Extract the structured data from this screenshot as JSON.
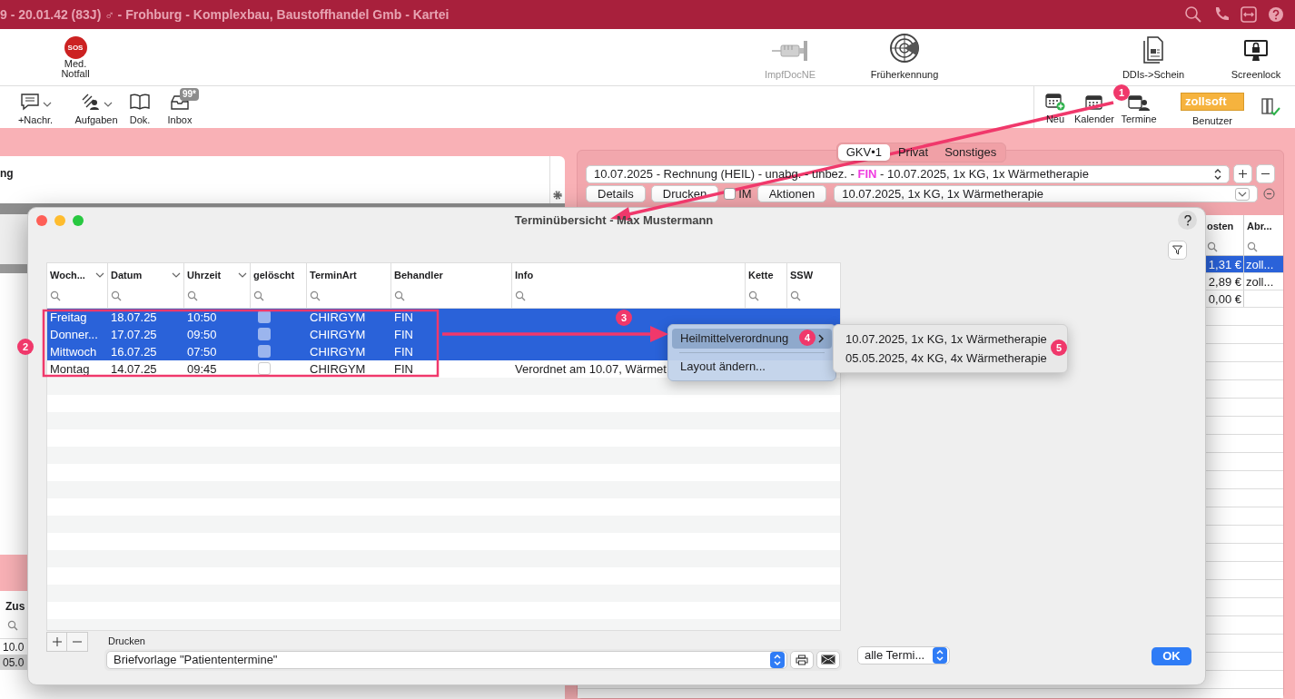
{
  "title_bar": {
    "title": "9 - 20.01.42 (83J) ♂ - Frohburg - Komplexbau, Baustoffhandel Gmb - Kartei",
    "icons": [
      {
        "kind": "search"
      },
      {
        "kind": "phone"
      },
      {
        "kind": "remote"
      },
      {
        "kind": "help"
      }
    ]
  },
  "main_toolbar": [
    {
      "kind": "sos",
      "badge": "SOS",
      "label": "Med. Notfall",
      "disabled": false
    },
    {
      "kind": "syringe",
      "label": "ImpfDocNE",
      "disabled": true
    },
    {
      "kind": "radar",
      "label": "Früherkennung",
      "disabled": false
    },
    {
      "kind": "document",
      "label": "DDIs->Schein",
      "disabled": false
    },
    {
      "kind": "lock",
      "label": "Screenlock",
      "disabled": false
    }
  ],
  "secondary_toolbar": {
    "left": [
      {
        "kind": "message",
        "label": "+Nachr.",
        "dropdown": true
      },
      {
        "kind": "tasks",
        "label": "Aufgaben",
        "dropdown": true
      },
      {
        "kind": "book",
        "label": "Dok.",
        "dropdown": false
      },
      {
        "kind": "inbox",
        "label": "Inbox",
        "dropdown": false,
        "badge": "99*"
      }
    ],
    "right": [
      {
        "kind": "calendar-new",
        "label": "Neu"
      },
      {
        "kind": "calendar",
        "label": "Kalender"
      },
      {
        "kind": "appointments",
        "label": "Termine"
      }
    ],
    "user": {
      "name": "zollsoft",
      "label": "Benutzer"
    }
  },
  "left_panel": {
    "card_text": "ng",
    "table": {
      "column": "Zus",
      "rows": [
        {
          "text": "10.0",
          "selected": false
        },
        {
          "text": "05.0",
          "selected": true
        }
      ]
    }
  },
  "right_panel": {
    "tabs": [
      {
        "label": "GKV•1",
        "selected": true
      },
      {
        "label": "Privat",
        "selected": false
      },
      {
        "label": "Sonstiges",
        "selected": false
      }
    ],
    "invoice_select": [
      {
        "text": "10.07.2025 - Rechnung (HEIL) - unabg. - unbez. - ",
        "highlight": false
      },
      {
        "text": "FIN",
        "highlight": true
      },
      {
        "text": " - 10.07.2025, 1x KG, 1x Wärmetherapie",
        "highlight": false
      }
    ],
    "buttons": [
      {
        "kind": "button",
        "label": "Details"
      },
      {
        "kind": "button",
        "label": "Drucken"
      },
      {
        "kind": "checkbox",
        "label": "IM",
        "checked": false
      },
      {
        "kind": "button",
        "label": "Aktionen"
      }
    ],
    "prescription_select": "10.07.2025, 1x KG, 1x Wärmetherapie",
    "table": {
      "columns": [
        "osten",
        "Abr..."
      ],
      "rows": [
        {
          "cells": [
            "1,31 €",
            "zoll..."
          ],
          "selected": true
        },
        {
          "cells": [
            "2,89 €",
            "zoll..."
          ],
          "selected": false
        },
        {
          "cells": [
            "0,00 €",
            ""
          ],
          "selected": false
        }
      ]
    }
  },
  "dialog": {
    "title": "Terminübersicht - Max Mustermann",
    "table": {
      "columns": [
        {
          "label": "Woch...",
          "sortable": true
        },
        {
          "label": "Datum",
          "sortable": true
        },
        {
          "label": "Uhrzeit",
          "sortable": true
        },
        {
          "label": "gelöscht",
          "sortable": false
        },
        {
          "label": "TerminArt",
          "sortable": false
        },
        {
          "label": "Behandler",
          "sortable": false
        },
        {
          "label": "Info",
          "sortable": false
        },
        {
          "label": "Kette",
          "sortable": false
        },
        {
          "label": "SSW",
          "sortable": false
        }
      ],
      "rows": [
        {
          "weekday": "Freitag",
          "date": "18.07.25",
          "time": "10:50",
          "deleted": false,
          "type": "CHIRGYM",
          "therapist": "FIN",
          "info": "",
          "selected": true
        },
        {
          "weekday": "Donner...",
          "date": "17.07.25",
          "time": "09:50",
          "deleted": false,
          "type": "CHIRGYM",
          "therapist": "FIN",
          "info": "",
          "selected": true
        },
        {
          "weekday": "Mittwoch",
          "date": "16.07.25",
          "time": "07:50",
          "deleted": false,
          "type": "CHIRGYM",
          "therapist": "FIN",
          "info": "",
          "selected": true
        },
        {
          "weekday": "Montag",
          "date": "14.07.25",
          "time": "09:45",
          "deleted": false,
          "type": "CHIRGYM",
          "therapist": "FIN",
          "info": "Verordnet am 10.07, Wärmet",
          "selected": false
        }
      ]
    },
    "print_label": "Drucken",
    "print_template": "Briefvorlage \"Patiententermine\"",
    "filter_select": "alle Termi...",
    "ok": "OK"
  },
  "context_menu": {
    "items": [
      {
        "label": "Heilmittelverordnung",
        "submenu": true,
        "selected": true
      },
      {
        "label": "Layout ändern...",
        "submenu": false,
        "selected": false
      }
    ],
    "submenu": [
      "10.07.2025, 1x KG, 1x Wärmetherapie",
      "05.05.2025, 4x KG, 4x Wärmetherapie"
    ]
  },
  "annotations": [
    "1",
    "2",
    "3",
    "4",
    "5"
  ]
}
